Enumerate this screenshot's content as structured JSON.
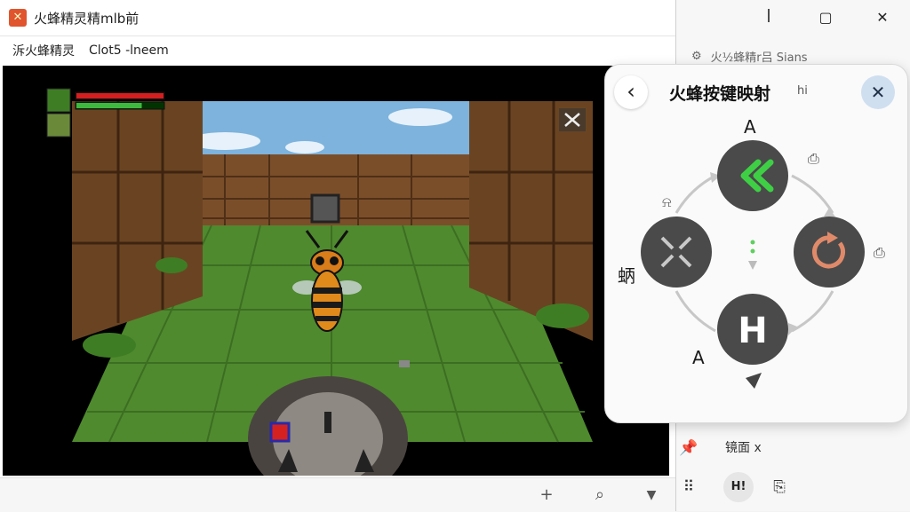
{
  "window": {
    "title": "火蜂精灵精mlb前",
    "app_icon": "game-logo-icon"
  },
  "menubar": {
    "items": [
      "泝火蜂精灵",
      "Clot5 -lneem"
    ]
  },
  "window_controls": {
    "minimize": "ꟾ",
    "maximize": "▢",
    "close": "✕"
  },
  "side_panel": {
    "header_text": "火½蜂精𝗋吕 Sians",
    "tool_label": "镜面 x",
    "pill_label": "H!"
  },
  "overlay": {
    "title": "火蜂按键映射",
    "subtitle": "hi",
    "labels": {
      "top": "A",
      "left": "蛃",
      "bottom_left": "A"
    },
    "buttons": [
      {
        "id": "top",
        "icon": "double-chevron-left-icon",
        "color": "#3ecf45"
      },
      {
        "id": "left",
        "icon": "shrink-arrows-icon",
        "color": "#bdbdbd"
      },
      {
        "id": "right",
        "icon": "refresh-icon",
        "color": "#e08a6a"
      },
      {
        "id": "bottom",
        "icon": "h-letter-icon",
        "text": "H",
        "color": "#ffffff"
      }
    ]
  },
  "game": {
    "health_fraction": 1.0,
    "stamina_fraction": 0.75,
    "hud_icons": [
      "map-thumbnail-icon",
      "character-portrait-icon",
      "crossed-swords-icon"
    ]
  },
  "statusbar": {
    "icons": [
      "plus-icon",
      "search-icon",
      "dropdown-arrow-icon"
    ]
  }
}
